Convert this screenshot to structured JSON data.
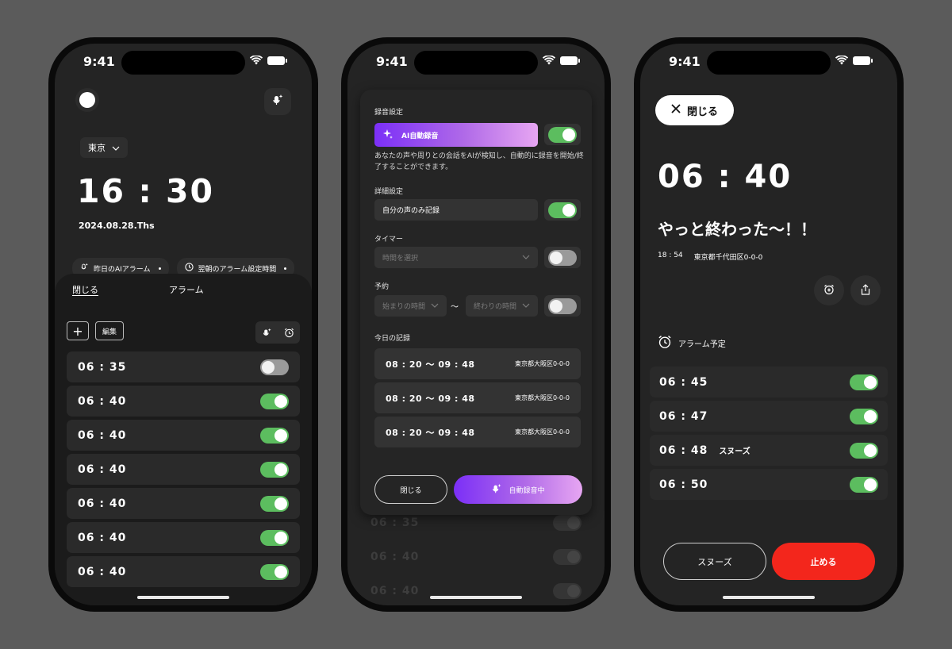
{
  "status": {
    "time": "9:41"
  },
  "phone1": {
    "city": "東京",
    "clock": "16 : 30",
    "date": "2024.08.28.Ths",
    "chips": [
      "昨日のAIアラーム",
      "翌朝のアラーム設定時間"
    ],
    "sheet": {
      "close_label": "閉じる",
      "title": "アラーム",
      "add_label": "+",
      "edit_label": "編集",
      "alarms": [
        {
          "time": "06 : 35",
          "on": false
        },
        {
          "time": "06 : 40",
          "on": true
        },
        {
          "time": "06 : 40",
          "on": true
        },
        {
          "time": "06 : 40",
          "on": true
        },
        {
          "time": "06 : 40",
          "on": true
        },
        {
          "time": "06 : 40",
          "on": true
        },
        {
          "time": "06 : 40",
          "on": true
        }
      ]
    }
  },
  "phone2": {
    "recording_settings_label": "録音設定",
    "ai_label": "AI自動録音",
    "ai_description": "あなたの声や周りとの会話をAIが検知し、自動的に録音を開始/終了することができます。",
    "detail_label": "詳細設定",
    "own_voice_label": "自分の声のみ記録",
    "timer_label": "タイマー",
    "timer_placeholder": "時間を選択",
    "reserve_label": "予約",
    "start_placeholder": "始まりの時間",
    "tilde": "〜",
    "end_placeholder": "終わりの時間",
    "today_label": "今日の記録",
    "records": [
      {
        "time": "08 : 20 〜 09 : 48",
        "address": "東京都大阪区0-0-0"
      },
      {
        "time": "08 : 20 〜 09 : 48",
        "address": "東京都大阪区0-0-0"
      },
      {
        "time": "08 : 20 〜 09 : 48",
        "address": "東京都大阪区0-0-0"
      }
    ],
    "close_label": "閉じる",
    "auto_label": "自動録音中",
    "background_alarms": [
      "06 : 35",
      "06 : 40",
      "06 : 40"
    ]
  },
  "phone3": {
    "close_label": "閉じる",
    "clock": "06 : 40",
    "message": "やっと終わった〜！！",
    "info_time": "18 : 54",
    "info_address": "東京都千代田区0-0-0",
    "schedule_label": "アラーム予定",
    "alarms": [
      {
        "time": "06 : 45",
        "tag": ""
      },
      {
        "time": "06 : 47",
        "tag": ""
      },
      {
        "time": "06 : 48",
        "tag": "スヌーズ"
      },
      {
        "time": "06 : 50",
        "tag": ""
      }
    ],
    "snooze_label": "スヌーズ",
    "stop_label": "止める"
  }
}
